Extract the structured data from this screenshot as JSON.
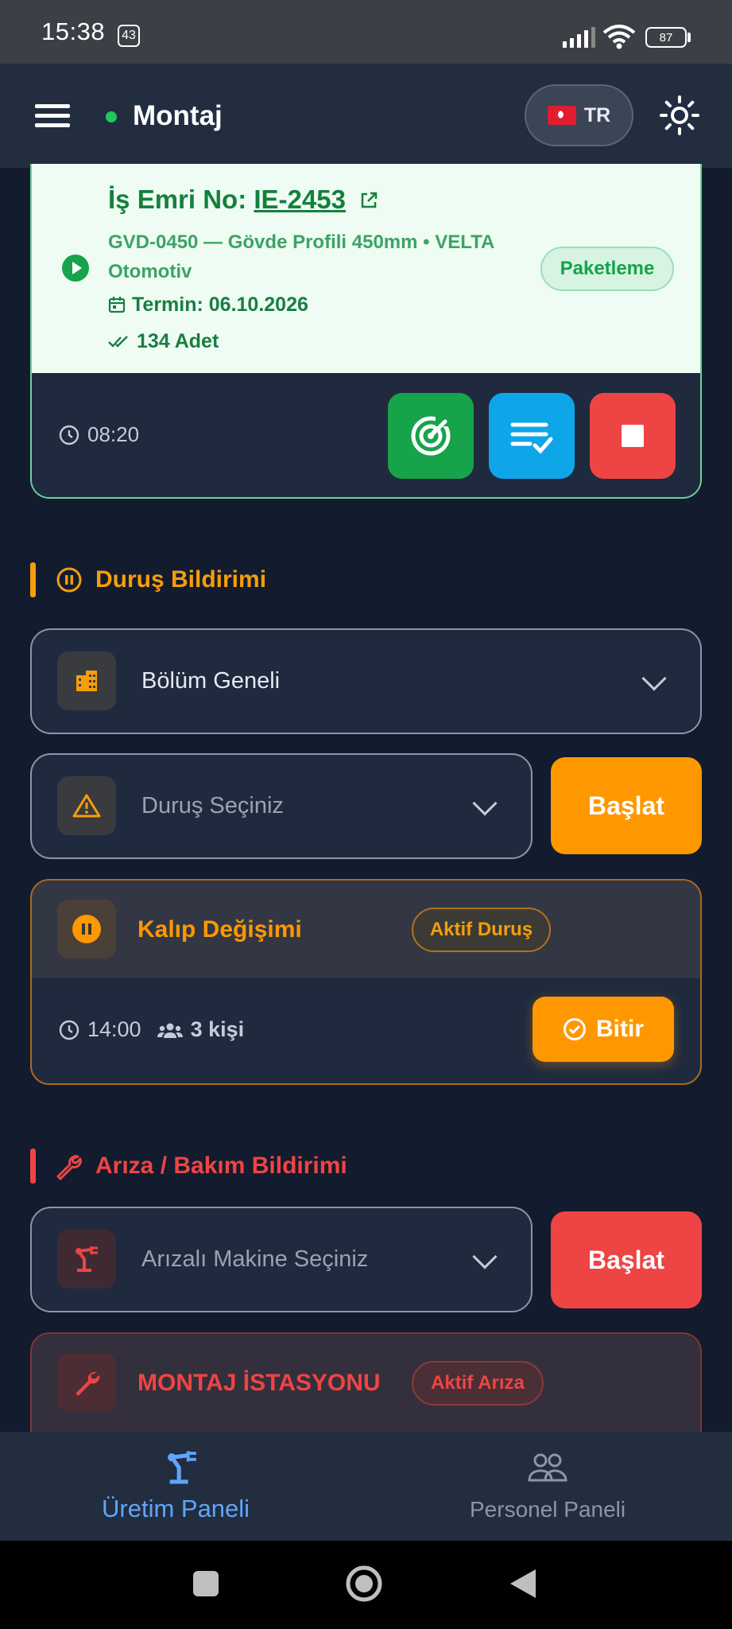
{
  "status_bar": {
    "time": "15:38",
    "notif_count": "43",
    "battery": "87"
  },
  "header": {
    "title": "Montaj",
    "language": "TR"
  },
  "work_order": {
    "label": "İş Emri No: ",
    "number": "IE-2453",
    "description": "GVD-0450 — Gövde Profili 450mm  •  VELTA Otomotiv",
    "due": "Termin: 06.10.2026",
    "quantity": "134 Adet",
    "status": "Paketleme",
    "time": "08:20"
  },
  "downtime": {
    "section_title": "Duruş Bildirimi",
    "department_value": "Bölüm Geneli",
    "reason_placeholder": "Duruş Seçiniz",
    "start_label": "Başlat",
    "active": {
      "title": "Kalıp Değişimi",
      "badge": "Aktif Duruş",
      "time": "14:00",
      "people": "3 kişi",
      "finish_label": "Bitir"
    }
  },
  "fault": {
    "section_title": "Arıza / Bakım Bildirimi",
    "machine_placeholder": "Arızalı Makine Seçiniz",
    "start_label": "Başlat",
    "active": {
      "title": "MONTAJ İSTASYONU",
      "badge": "Aktif Arıza"
    }
  },
  "bottom_nav": {
    "production": "Üretim Paneli",
    "personnel": "Personel Paneli"
  },
  "colors": {
    "accent_green": "#16a34a",
    "accent_orange": "#ff9800",
    "accent_red": "#ef4444",
    "accent_blue": "#0ea5e9",
    "nav_active": "#60a5fa"
  }
}
